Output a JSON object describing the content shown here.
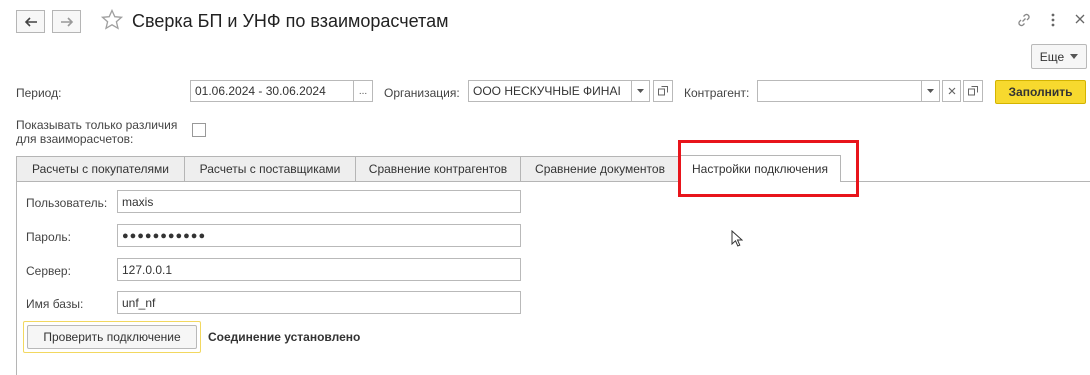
{
  "window": {
    "title": "Сверка БП и УНФ по взаиморасчетам",
    "more_button": "Еще"
  },
  "filters": {
    "period_label": "Период:",
    "period_value": "01.06.2024 - 30.06.2024",
    "period_picker": "...",
    "org_label": "Организация:",
    "org_value": "ООО НЕСКУЧНЫЕ ФИНАІ",
    "counterparty_label": "Контрагент:",
    "counterparty_value": "",
    "fill_button": "Заполнить",
    "only_diff_label_line1": "Показывать только различия",
    "only_diff_label_line2": "для взаиморасчетов:"
  },
  "tabs": [
    {
      "label": "Расчеты с покупателями"
    },
    {
      "label": "Расчеты с поставщиками"
    },
    {
      "label": "Сравнение контрагентов"
    },
    {
      "label": "Сравнение документов"
    },
    {
      "label": "Настройки подключения"
    }
  ],
  "connection": {
    "user_label": "Пользователь:",
    "user_value": "maxis",
    "password_label": "Пароль:",
    "password_value": "●●●●●●●●●●●",
    "server_label": "Сервер:",
    "server_value": "127.0.0.1",
    "db_label": "Имя базы:",
    "db_value": "unf_nf",
    "check_button": "Проверить подключение",
    "status_text": "Соединение установлено"
  },
  "colors": {
    "highlight": "#e8141b",
    "accent_yellow": "#f7d92e"
  }
}
